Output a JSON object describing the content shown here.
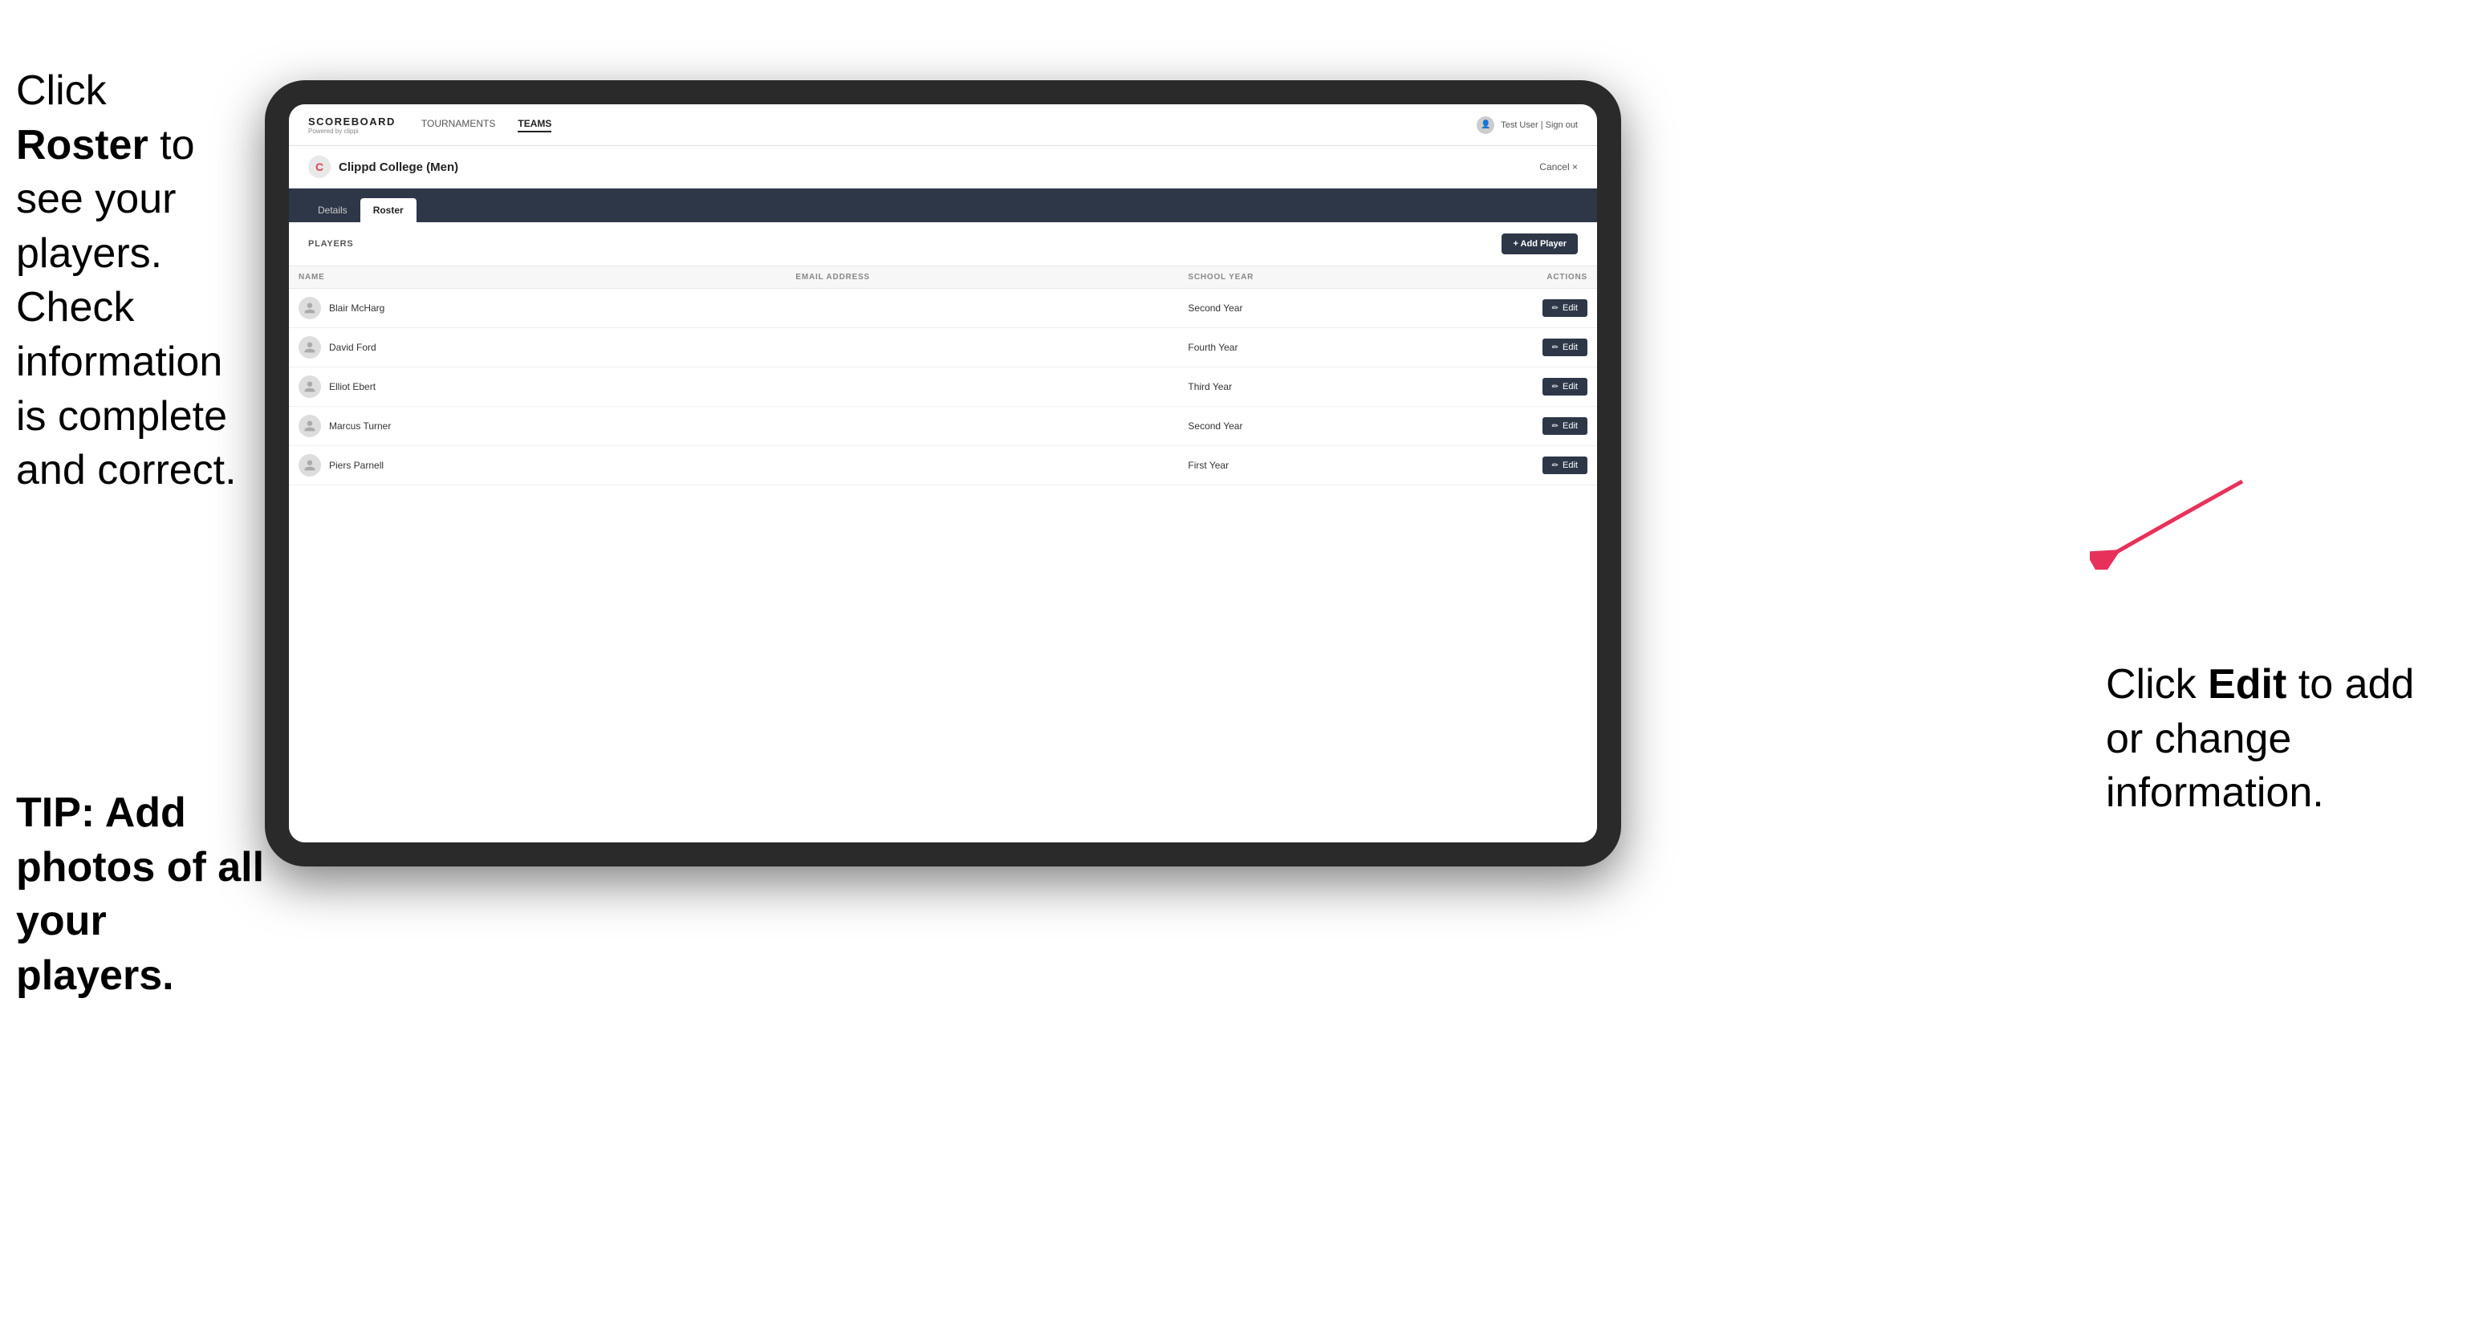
{
  "annotations": {
    "left_top_text1": "Click ",
    "left_top_bold": "Roster",
    "left_top_text2": " to see your players. Check information is complete and correct.",
    "tip_text": "TIP: Add photos of all your players.",
    "right_text1": "Click ",
    "right_bold": "Edit",
    "right_text2": " to add or change information."
  },
  "navbar": {
    "logo_title": "SCOREBOARD",
    "logo_sub": "Powered by clippi",
    "nav_items": [
      {
        "label": "TOURNAMENTS",
        "active": false
      },
      {
        "label": "TEAMS",
        "active": true
      }
    ],
    "user_text": "Test User | Sign out"
  },
  "team_header": {
    "logo_letter": "C",
    "team_name": "Clippd College (Men)",
    "cancel_label": "Cancel ×"
  },
  "tabs": [
    {
      "label": "Details",
      "active": false
    },
    {
      "label": "Roster",
      "active": true
    }
  ],
  "players_section": {
    "label": "PLAYERS",
    "add_button_label": "+ Add Player",
    "columns": {
      "name": "NAME",
      "email": "EMAIL ADDRESS",
      "school_year": "SCHOOL YEAR",
      "actions": "ACTIONS"
    },
    "players": [
      {
        "name": "Blair McHarg",
        "email": "",
        "school_year": "Second Year"
      },
      {
        "name": "David Ford",
        "email": "",
        "school_year": "Fourth Year"
      },
      {
        "name": "Elliot Ebert",
        "email": "",
        "school_year": "Third Year"
      },
      {
        "name": "Marcus Turner",
        "email": "",
        "school_year": "Second Year"
      },
      {
        "name": "Piers Parnell",
        "email": "",
        "school_year": "First Year"
      }
    ],
    "edit_button_label": "Edit"
  }
}
